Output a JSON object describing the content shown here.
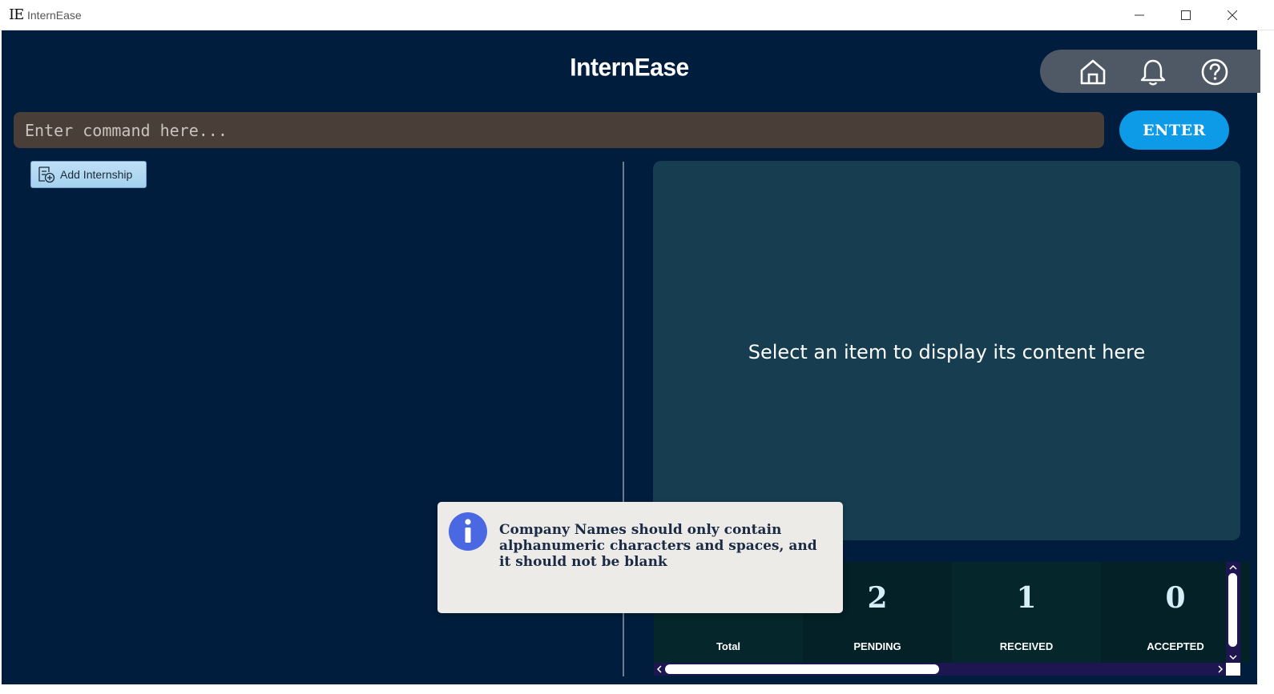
{
  "window": {
    "logo": "IE",
    "title": "InternEase"
  },
  "header": {
    "title": "InternEase"
  },
  "command": {
    "placeholder": "Enter command here...",
    "enter_label": "ENTER"
  },
  "toolbar": {
    "add_label": "Add Internship"
  },
  "detail": {
    "placeholder": "Select an item to display its content here"
  },
  "stats": [
    {
      "value": "",
      "label": "Total"
    },
    {
      "value": "2",
      "label": "PENDING"
    },
    {
      "value": "1",
      "label": "RECEIVED"
    },
    {
      "value": "0",
      "label": "ACCEPTED"
    }
  ],
  "popup": {
    "message": "Company Names should only contain alphanumeric characters and spaces, and it should not be blank",
    "icon": "info-icon"
  },
  "icons": {
    "home": "home-icon",
    "notifications": "bell-icon",
    "help": "help-icon"
  },
  "colors": {
    "background": "#011d3d",
    "accent": "#0d9ae6",
    "panel": "#163e50"
  }
}
